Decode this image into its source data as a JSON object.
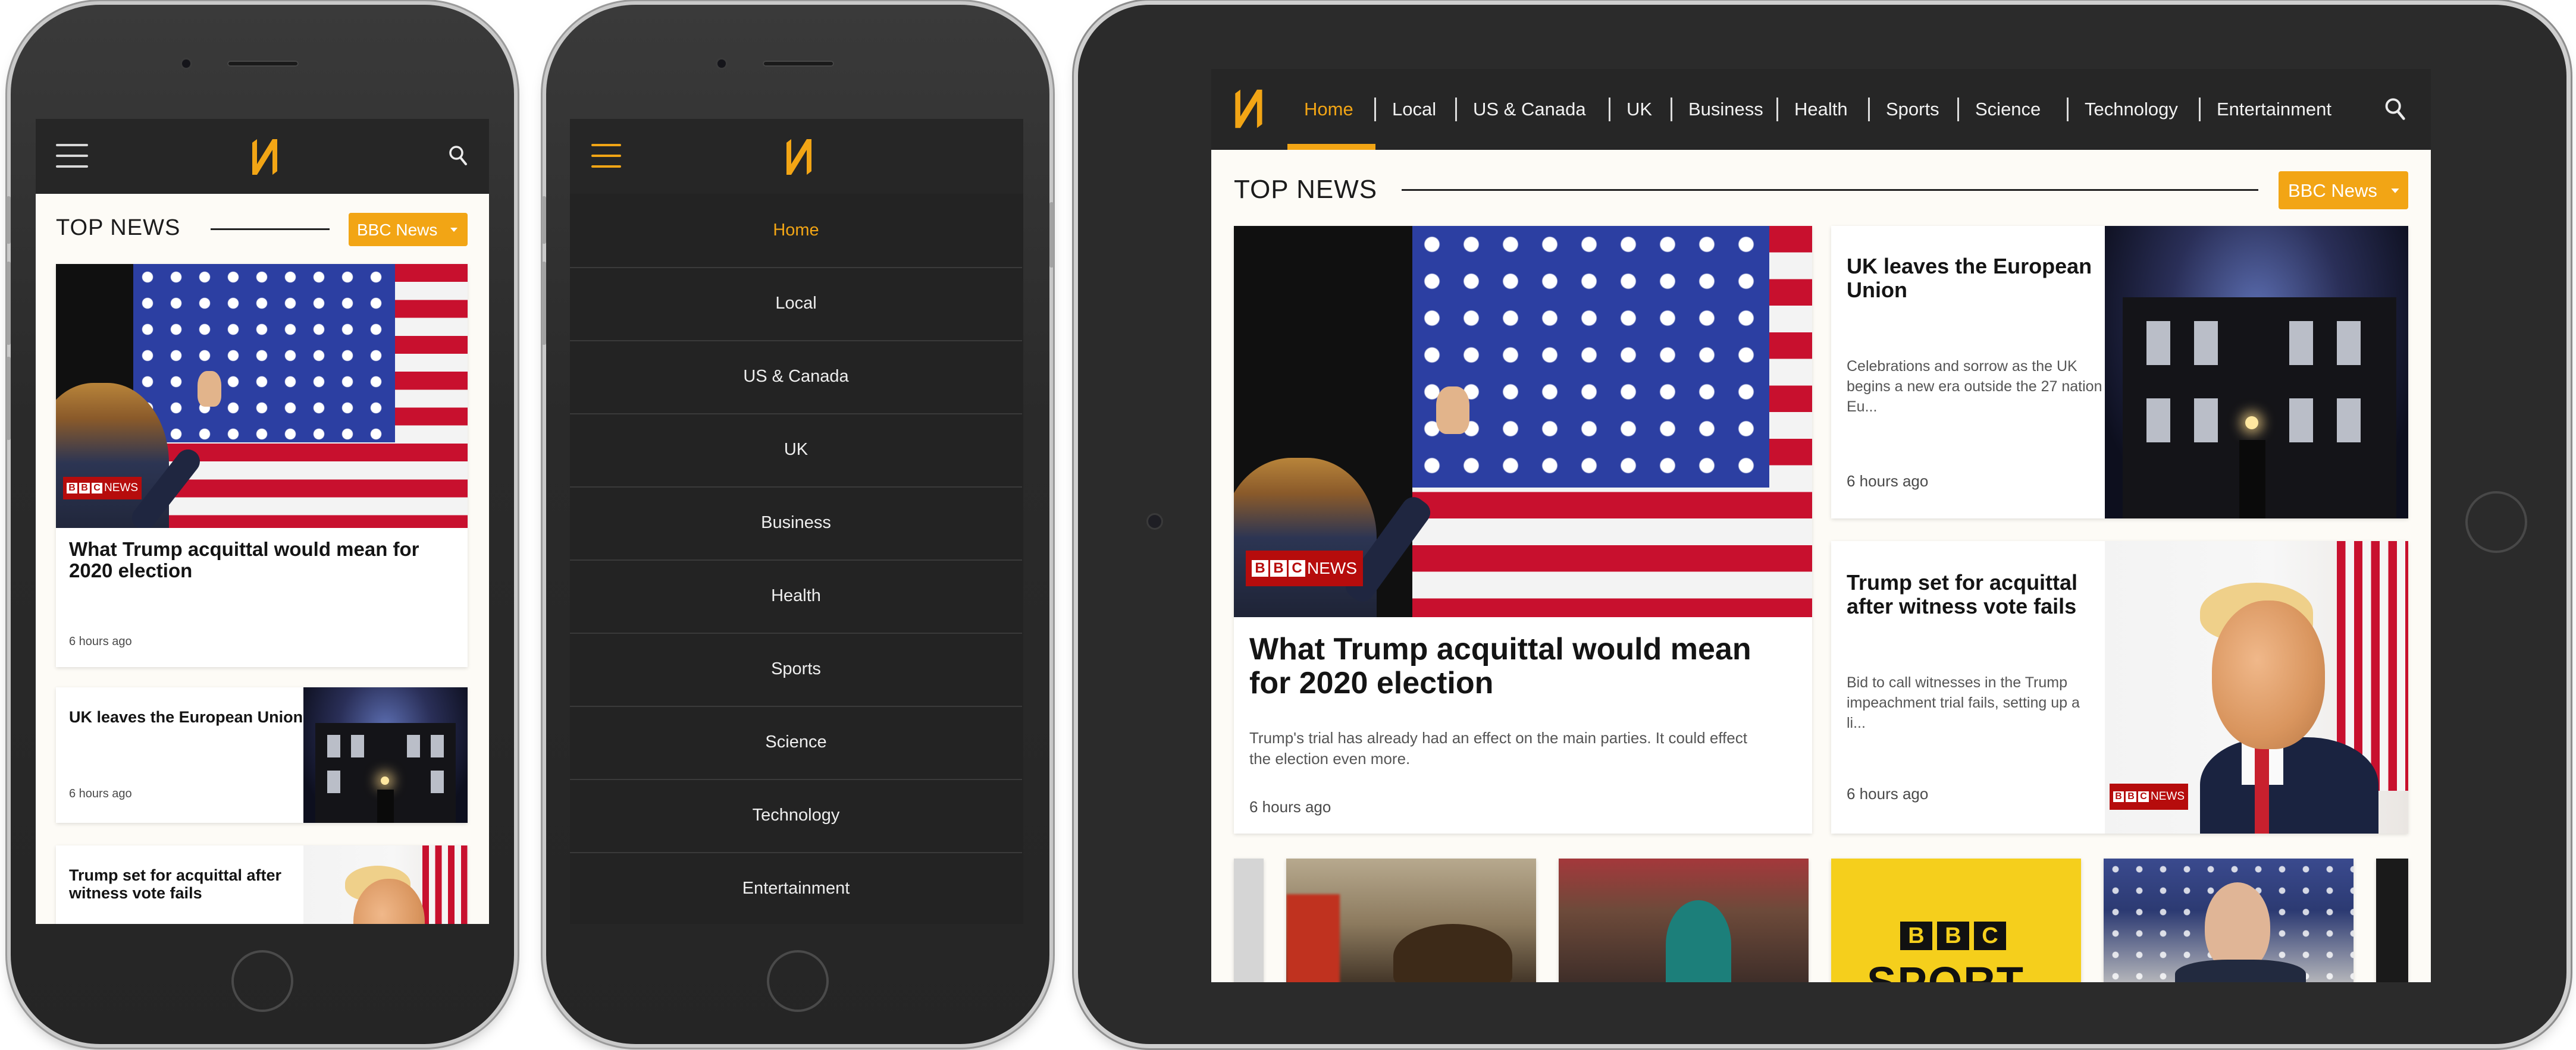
{
  "brand": {
    "logo_letter": "N",
    "accent": "#f2a515",
    "nav_bg": "#262626"
  },
  "section": {
    "title": "TOP NEWS",
    "source_select": "BBC News"
  },
  "badge": {
    "bbc": "BBC",
    "news": "NEWS",
    "sport_bbc": "BBC",
    "sport": "SPORT"
  },
  "nav": {
    "items": [
      "Home",
      "Local",
      "US & Canada",
      "UK",
      "Business",
      "Health",
      "Sports",
      "Science",
      "Technology",
      "Entertainment"
    ],
    "active": "Home"
  },
  "articles": [
    {
      "title": "What Trump acquittal would mean for 2020 election",
      "excerpt": "Trump's trial has already had an effect on the main parties. It could effect the election even more.",
      "time": "6 hours ago"
    },
    {
      "title": "UK leaves the European Union",
      "excerpt": "Celebrations and sorrow as the UK begins a new era outside the 27 nation Eu...",
      "time": "6 hours ago"
    },
    {
      "title": "Trump set for acquittal after witness vote fails",
      "excerpt": "Bid to call witnesses in the Trump impeachment trial fails, setting up a li...",
      "time": "6 hours ago"
    }
  ],
  "icons": {
    "menu": "hamburger-icon",
    "search": "search-icon",
    "caret": "caret-down-icon"
  }
}
